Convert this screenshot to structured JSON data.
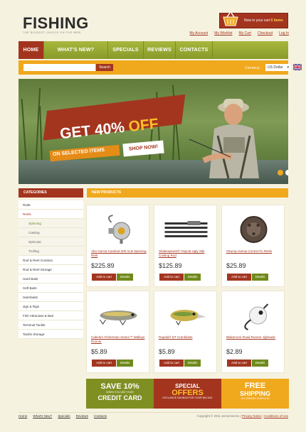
{
  "header": {
    "logo": "FISHING",
    "tagline": "The biggest choice on the web",
    "cart": {
      "prefix": "Now in your cart",
      "count": "0 items"
    },
    "links": [
      "My Account",
      "My Wishlist",
      "My Cart",
      "Checkout",
      "Log In"
    ]
  },
  "nav": {
    "items": [
      "HOME",
      "WHAT'S NEW?",
      "SPECIALS",
      "REVIEWS",
      "CONTACTS"
    ],
    "active": 0
  },
  "search": {
    "placeholder": "",
    "button": "Search",
    "currency_label": "Currency:",
    "currency_value": "US Dollar"
  },
  "banner": {
    "title_a": "GET ",
    "title_b": "40% ",
    "title_c": "OFF",
    "subtitle": "ON SELECTED ITEMS",
    "cta": "SHOP NOW!"
  },
  "sidebar": {
    "heading": "CATEGORIES",
    "items": [
      {
        "label": "Rods",
        "level": 0,
        "active": false
      },
      {
        "label": "Reels",
        "level": 0,
        "active": true
      },
      {
        "label": "Spinning",
        "level": 1,
        "active": true
      },
      {
        "label": "Casting",
        "level": 1,
        "active": false
      },
      {
        "label": "Spincast",
        "level": 1,
        "active": false
      },
      {
        "label": "Trolling",
        "level": 1,
        "active": false
      },
      {
        "label": "Rod & Reel Combos",
        "level": 0,
        "active": false
      },
      {
        "label": "Rod & Reel Storage",
        "level": 0,
        "active": false
      },
      {
        "label": "Hard Baits",
        "level": 0,
        "active": false
      },
      {
        "label": "Soft Baits",
        "level": 0,
        "active": false
      },
      {
        "label": "Swimbaits",
        "level": 0,
        "active": false
      },
      {
        "label": "Jigs & Rigs",
        "level": 0,
        "active": false
      },
      {
        "label": "Fish Attractant & Bait",
        "level": 0,
        "active": false
      },
      {
        "label": "Terminal Tackle",
        "level": 0,
        "active": false
      },
      {
        "label": "Tackle Storage",
        "level": 0,
        "active": false
      }
    ]
  },
  "products": {
    "heading": "NEW PRODUCTS",
    "add_label": "Add to cart",
    "details_label": "Details",
    "items": [
      {
        "name": "Abu Garcia Cardinal 300 ALB Spinning Reel",
        "price": "$225.89",
        "icon": "spinning-reel-icon"
      },
      {
        "name": "Shakespeare® Ospcat Ugly Stik Casting Rod",
        "price": "$125.89",
        "icon": "fishing-rod-icon"
      },
      {
        "name": "Okuma Avenia Contra Fin Reels",
        "price": "$25.89",
        "icon": "fly-reel-icon"
      },
      {
        "name": "Cabela's Fisherman Series™ Walleye Runner",
        "price": "$5.89",
        "icon": "lure-icon"
      },
      {
        "name": "Rapala® DT Crankbaits",
        "price": "$5.89",
        "icon": "crankbait-icon"
      },
      {
        "name": "Blakemore Road Runner Jigheads",
        "price": "$2.89",
        "icon": "jighead-icon"
      }
    ]
  },
  "promos": [
    {
      "top": "SAVE 10%",
      "small": "WHEN YOU USE YOUR",
      "bottom": "CREDIT CARD"
    },
    {
      "top": "SPECIAL",
      "mid": "OFFERS",
      "small": "EXCLUSIVE SAVINGS FOR YOUR BIG DAY"
    },
    {
      "top": "FREE",
      "mid": "SHIPPING",
      "small": "ON ORDERS OVER $ 99"
    }
  ],
  "footer": {
    "links": [
      "Home",
      "What's New?",
      "Specials",
      "Reviews",
      "Contacts"
    ],
    "copyright": "Copyright © 2011 osCommerce |",
    "privacy": "Privacy Notice",
    "sep": "|",
    "conditions": "Conditions of Use"
  },
  "colors": {
    "brand_red": "#a3351f",
    "brand_green": "#8a9a2a",
    "brand_orange": "#f0a81d"
  }
}
